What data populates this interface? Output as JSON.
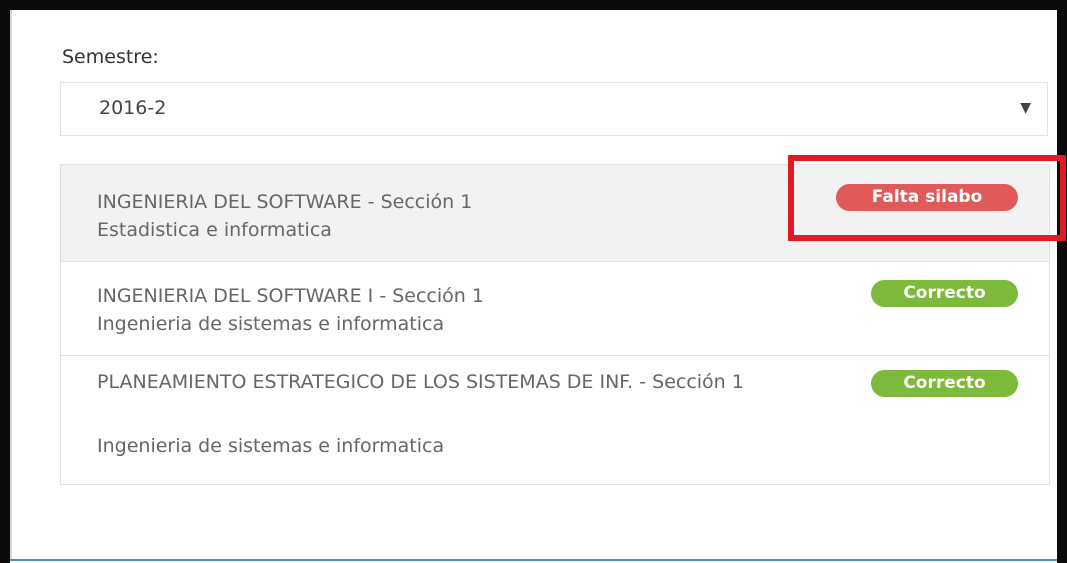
{
  "semester": {
    "label": "Semestre:",
    "selected": "2016-2"
  },
  "courses": [
    {
      "title": "INGENIERIA DEL SOFTWARE - Sección 1",
      "faculty": "Estadistica e informatica",
      "status": "Falta silabo",
      "status_color": "#e05a5a"
    },
    {
      "title": "INGENIERIA DEL SOFTWARE I - Sección 1",
      "faculty": "Ingenieria de sistemas e informatica",
      "status": "Correcto",
      "status_color": "#7dba3c"
    },
    {
      "title": "PLANEAMIENTO ESTRATEGICO DE LOS SISTEMAS DE INF. - Sección 1",
      "faculty": "Ingenieria de sistemas e informatica",
      "status": "Correcto",
      "status_color": "#7dba3c"
    }
  ],
  "colors": {
    "highlight": "#e01b24",
    "active_row": "#f2f2f2"
  }
}
